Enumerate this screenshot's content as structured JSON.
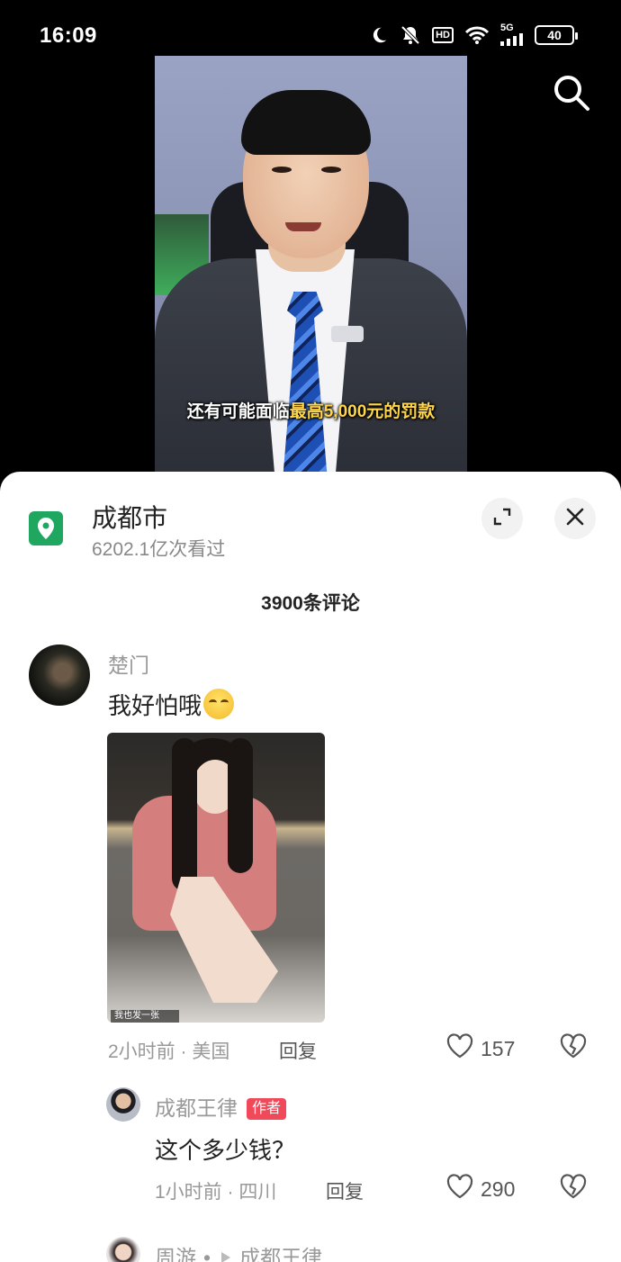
{
  "status_bar": {
    "time": "16:09",
    "network": "5G",
    "hd": "HD",
    "battery": "40"
  },
  "video": {
    "subtitle_pre": "还有可能面临",
    "subtitle_highlight": "最高5,000元的罚",
    "subtitle_post": "款",
    "highlight_color": "#ffd54a"
  },
  "sheet": {
    "location_title": "成都市",
    "view_count": "6202.1亿次看过",
    "comment_count": "3900条评论",
    "brand_color": "#1fa760"
  },
  "comments": [
    {
      "user": "楚门",
      "text": "我好怕哦",
      "emoji": "smirk-emoji",
      "image_caption": "我也发一张",
      "meta": "2小时前 · 美国",
      "reply_label": "回复",
      "likes": "157"
    }
  ],
  "replies": [
    {
      "user": "成都王律",
      "badge": "作者",
      "text": "这个多少钱？",
      "meta": "1小时前 · 四川",
      "reply_label": "回复",
      "likes": "290"
    },
    {
      "user": "周游",
      "target": "成都王律"
    }
  ],
  "colors": {
    "badge": "#f0495a",
    "muted": "#999999"
  }
}
